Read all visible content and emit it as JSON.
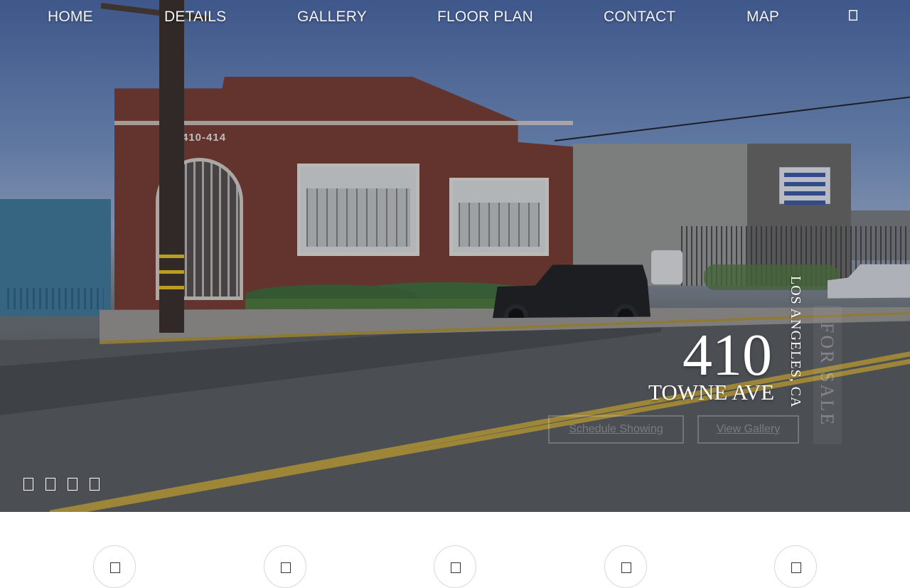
{
  "nav": {
    "items": [
      "HOME",
      "DETAILS",
      "GALLERY",
      "FLOOR PLAN",
      "CONTACT",
      "MAP"
    ],
    "extra_icon": "menu-icon"
  },
  "hero": {
    "number": "410",
    "street": "TOWNE AVE",
    "city": "LOS ANGELES, CA",
    "status": "FOR SALE",
    "building_label": "410-414",
    "schedule_button": "Schedule Showing",
    "gallery_button": "View Gallery",
    "slide_count": 4
  },
  "features": {
    "count": 5,
    "icons": [
      "feature-icon",
      "feature-icon",
      "feature-icon",
      "feature-icon",
      "feature-icon"
    ]
  }
}
